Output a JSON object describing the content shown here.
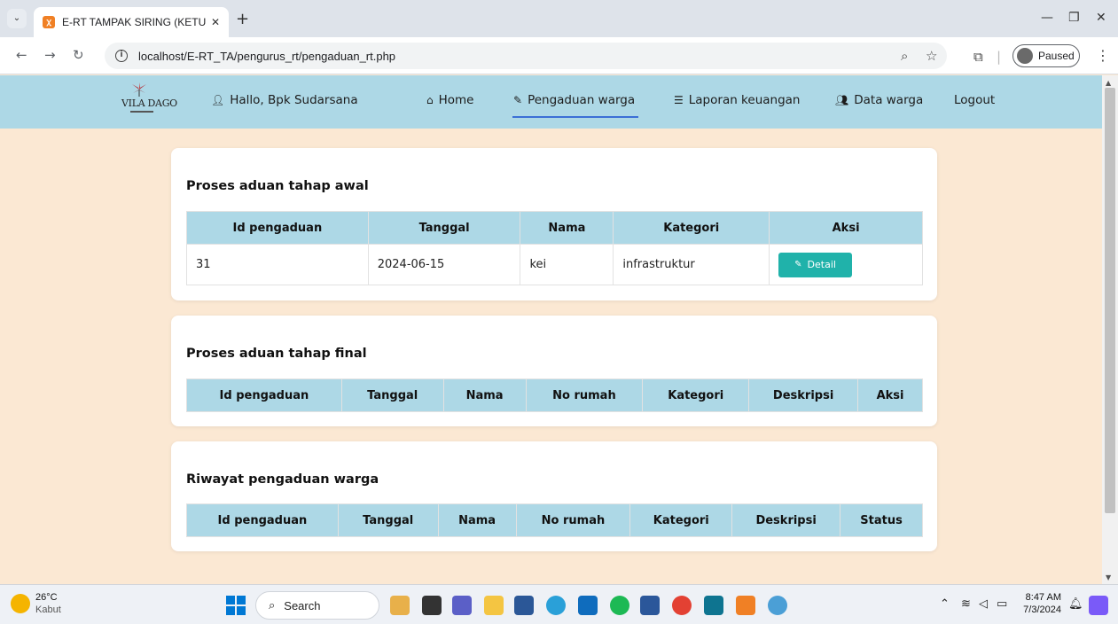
{
  "browser": {
    "tab_title": "E-RT TAMPAK SIRING (KETUA RT",
    "url": "localhost/E-RT_TA/pengurus_rt/pengaduan_rt.php",
    "profile_status": "Paused"
  },
  "navbar": {
    "logo_text": "VILA DAGO",
    "greeting": "Hallo, Bpk Sudarsana",
    "items": [
      {
        "label": "Home",
        "icon": "home-icon"
      },
      {
        "label": "Pengaduan warga",
        "icon": "edit-icon",
        "active": true
      },
      {
        "label": "Laporan keuangan",
        "icon": "database-icon"
      },
      {
        "label": "Data warga",
        "icon": "users-icon"
      },
      {
        "label": "Logout"
      }
    ],
    "active_color": "#3b6fd6",
    "background": "#add8e6"
  },
  "sections": {
    "awal": {
      "title": "Proses aduan tahap awal",
      "headers": [
        "Id pengaduan",
        "Tanggal",
        "Nama",
        "Kategori",
        "Aksi"
      ],
      "rows": [
        {
          "id": "31",
          "tanggal": "2024-06-15",
          "nama": "kei",
          "kategori": "infrastruktur",
          "aksi": "Detail"
        }
      ]
    },
    "final": {
      "title": "Proses aduan tahap final",
      "headers": [
        "Id pengaduan",
        "Tanggal",
        "Nama",
        "No rumah",
        "Kategori",
        "Deskripsi",
        "Aksi"
      ]
    },
    "riwayat": {
      "title": "Riwayat pengaduan warga",
      "headers": [
        "Id pengaduan",
        "Tanggal",
        "Nama",
        "No rumah",
        "Kategori",
        "Deskripsi",
        "Status"
      ]
    }
  },
  "taskbar": {
    "weather_temp": "26°C",
    "weather_cond": "Kabut",
    "search_label": "Search",
    "time": "8:47 AM",
    "date": "7/3/2024"
  },
  "colors": {
    "page_bg": "#fbe8d3",
    "header_bg": "#add8e6",
    "detail_button": "#20b2aa"
  }
}
